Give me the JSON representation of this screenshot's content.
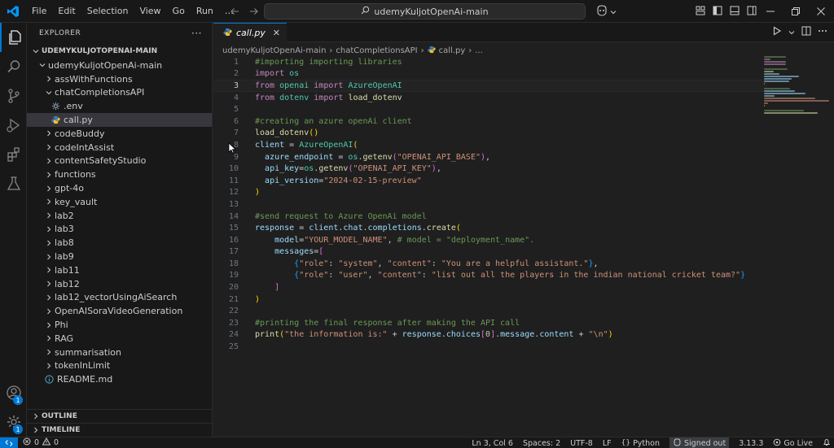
{
  "title_bar": {
    "menus": [
      "File",
      "Edit",
      "Selection",
      "View",
      "Go",
      "Run",
      "…"
    ],
    "search_text": "udemyKuljotOpenAi-main",
    "icons": [
      "vscode-logo",
      "back-arrow-icon",
      "forward-arrow-icon",
      "search-icon",
      "copilot-icon",
      "toggle-primary-sidebar-icon",
      "toggle-panel-icon",
      "toggle-secondary-sidebar-icon",
      "customize-layout-icon",
      "minimize-icon",
      "restore-icon",
      "close-icon"
    ]
  },
  "activity_bar": {
    "items": [
      "explorer-icon",
      "search-icon",
      "source-control-icon",
      "run-debug-icon",
      "extensions-icon",
      "testing-icon"
    ],
    "bottom": [
      {
        "icon": "accounts-icon",
        "badge": "1"
      },
      {
        "icon": "manage-gear-icon",
        "badge": "1"
      }
    ]
  },
  "sidebar": {
    "header": "EXPLORER",
    "more": "···",
    "root": "UDEMYKULJOTOPENAI-MAIN",
    "tree": [
      {
        "label": "udemyKuljotOpenAi-main",
        "type": "folder-open",
        "depth": 0
      },
      {
        "label": "assWithFunctions",
        "type": "folder",
        "depth": 1
      },
      {
        "label": "chatCompletionsAPI",
        "type": "folder-open",
        "depth": 1
      },
      {
        "label": ".env",
        "type": "env",
        "depth": 2
      },
      {
        "label": "call.py",
        "type": "python",
        "depth": 2,
        "selected": true
      },
      {
        "label": "codeBuddy",
        "type": "folder",
        "depth": 1
      },
      {
        "label": "codeIntAssist",
        "type": "folder",
        "depth": 1
      },
      {
        "label": "contentSafetyStudio",
        "type": "folder",
        "depth": 1
      },
      {
        "label": "functions",
        "type": "folder",
        "depth": 1
      },
      {
        "label": "gpt-4o",
        "type": "folder",
        "depth": 1
      },
      {
        "label": "key_vault",
        "type": "folder",
        "depth": 1
      },
      {
        "label": "lab2",
        "type": "folder",
        "depth": 1
      },
      {
        "label": "lab3",
        "type": "folder",
        "depth": 1
      },
      {
        "label": "lab8",
        "type": "folder",
        "depth": 1
      },
      {
        "label": "lab9",
        "type": "folder",
        "depth": 1
      },
      {
        "label": "lab11",
        "type": "folder",
        "depth": 1
      },
      {
        "label": "lab12",
        "type": "folder",
        "depth": 1
      },
      {
        "label": "lab12_vectorUsingAiSearch",
        "type": "folder",
        "depth": 1
      },
      {
        "label": "OpenAISoraVideoGeneration",
        "type": "folder",
        "depth": 1
      },
      {
        "label": "Phi",
        "type": "folder",
        "depth": 1
      },
      {
        "label": "RAG",
        "type": "folder",
        "depth": 1
      },
      {
        "label": "summarisation",
        "type": "folder",
        "depth": 1
      },
      {
        "label": "tokenInLimit",
        "type": "folder",
        "depth": 1
      },
      {
        "label": "README.md",
        "type": "info",
        "depth": 1
      }
    ],
    "outline": "OUTLINE",
    "timeline": "TIMELINE"
  },
  "editor": {
    "tab_label": "call.py",
    "tab_close": "✕",
    "breadcrumbs": [
      "udemyKuljotOpenAi-main",
      "chatCompletionsAPI",
      "call.py",
      "..."
    ],
    "breadcrumb_sep": "›",
    "current_line": 3,
    "lines": [
      [
        [
          "cmt",
          "#importing importing libraries"
        ]
      ],
      [
        [
          "kw",
          "import"
        ],
        [
          "",
          " "
        ],
        [
          "cls",
          "os"
        ]
      ],
      [
        [
          "kw",
          "from"
        ],
        [
          "",
          " "
        ],
        [
          "cls",
          "openai"
        ],
        [
          "",
          " "
        ],
        [
          "kw",
          "import"
        ],
        [
          "",
          " "
        ],
        [
          "cls",
          "AzureOpenAI"
        ]
      ],
      [
        [
          "kw",
          "from"
        ],
        [
          "",
          " "
        ],
        [
          "cls",
          "dotenv"
        ],
        [
          "",
          " "
        ],
        [
          "kw",
          "import"
        ],
        [
          "",
          " "
        ],
        [
          "fn",
          "load_dotenv"
        ]
      ],
      [],
      [
        [
          "cmt",
          "#creating an azure openAi client"
        ]
      ],
      [
        [
          "fn",
          "load_dotenv"
        ],
        [
          "p1",
          "()"
        ]
      ],
      [
        [
          "var",
          "client"
        ],
        [
          "",
          " = "
        ],
        [
          "cls",
          "AzureOpenAI"
        ],
        [
          "p1",
          "("
        ]
      ],
      [
        [
          "",
          "  "
        ],
        [
          "var",
          "azure_endpoint"
        ],
        [
          "",
          " = "
        ],
        [
          "cls",
          "os"
        ],
        [
          "",
          "."
        ],
        [
          "fn",
          "getenv"
        ],
        [
          "p2",
          "("
        ],
        [
          "str",
          "\"OPENAI_API_BASE\""
        ],
        [
          "p2",
          ")"
        ],
        [
          "",
          ","
        ]
      ],
      [
        [
          "",
          "  "
        ],
        [
          "var",
          "api_key"
        ],
        [
          "",
          "="
        ],
        [
          "cls",
          "os"
        ],
        [
          "",
          "."
        ],
        [
          "fn",
          "getenv"
        ],
        [
          "p2",
          "("
        ],
        [
          "str",
          "\"OPENAI_API_KEY\""
        ],
        [
          "p2",
          ")"
        ],
        [
          "",
          ","
        ]
      ],
      [
        [
          "",
          "  "
        ],
        [
          "var",
          "api_version"
        ],
        [
          "",
          "="
        ],
        [
          "str",
          "\"2024-02-15-preview\""
        ]
      ],
      [
        [
          "p1",
          ")"
        ]
      ],
      [],
      [
        [
          "cmt",
          "#send request to Azure OpenAi model"
        ]
      ],
      [
        [
          "var",
          "response"
        ],
        [
          "",
          " = "
        ],
        [
          "var",
          "client"
        ],
        [
          "",
          "."
        ],
        [
          "var",
          "chat"
        ],
        [
          "",
          "."
        ],
        [
          "var",
          "completions"
        ],
        [
          "",
          "."
        ],
        [
          "fn",
          "create"
        ],
        [
          "p1",
          "("
        ]
      ],
      [
        [
          "",
          "    "
        ],
        [
          "var",
          "model"
        ],
        [
          "",
          "="
        ],
        [
          "str",
          "\"YOUR_MODEL_NAME\""
        ],
        [
          "",
          ", "
        ],
        [
          "cmt",
          "# model = \"deployment_name\"."
        ]
      ],
      [
        [
          "",
          "    "
        ],
        [
          "var",
          "messages"
        ],
        [
          "",
          "="
        ],
        [
          "p2",
          "["
        ]
      ],
      [
        [
          "",
          "        "
        ],
        [
          "p3",
          "{"
        ],
        [
          "str",
          "\"role\""
        ],
        [
          "",
          ": "
        ],
        [
          "str",
          "\"system\""
        ],
        [
          "",
          ", "
        ],
        [
          "str",
          "\"content\""
        ],
        [
          "",
          ": "
        ],
        [
          "str",
          "\"You are a helpful assistant.\""
        ],
        [
          "p3",
          "}"
        ],
        [
          "",
          ","
        ]
      ],
      [
        [
          "",
          "        "
        ],
        [
          "p3",
          "{"
        ],
        [
          "str",
          "\"role\""
        ],
        [
          "",
          ": "
        ],
        [
          "str",
          "\"user\""
        ],
        [
          "",
          ", "
        ],
        [
          "str",
          "\"content\""
        ],
        [
          "",
          ": "
        ],
        [
          "str",
          "\"list out all the players in the indian national cricket team?\""
        ],
        [
          "p3",
          "}"
        ]
      ],
      [
        [
          "",
          "    "
        ],
        [
          "p2",
          "]"
        ]
      ],
      [
        [
          "p1",
          ")"
        ]
      ],
      [],
      [
        [
          "cmt",
          "#printing the final response after making the API call"
        ]
      ],
      [
        [
          "fn",
          "print"
        ],
        [
          "p1",
          "("
        ],
        [
          "str",
          "\"the information is:\""
        ],
        [
          "",
          " + "
        ],
        [
          "var",
          "response"
        ],
        [
          "",
          "."
        ],
        [
          "var",
          "choices"
        ],
        [
          "p2",
          "["
        ],
        [
          "num",
          "0"
        ],
        [
          "p2",
          "]"
        ],
        [
          "",
          "."
        ],
        [
          "var",
          "message"
        ],
        [
          "",
          "."
        ],
        [
          "var",
          "content"
        ],
        [
          "",
          " + "
        ],
        [
          "str",
          "\"\\n\""
        ],
        [
          "p1",
          ")"
        ]
      ],
      []
    ]
  },
  "status_bar": {
    "errors": "0",
    "warnings": "0",
    "position": "Ln 3, Col 6",
    "spaces": "Spaces: 2",
    "encoding": "UTF-8",
    "eol": "LF",
    "language": "Python",
    "signed_out": "Signed out",
    "version": "3.13.3",
    "go_live": "Go Live"
  },
  "colors": {
    "accent": "#0078d4",
    "background": "#1f1f1f",
    "chrome": "#181818"
  }
}
